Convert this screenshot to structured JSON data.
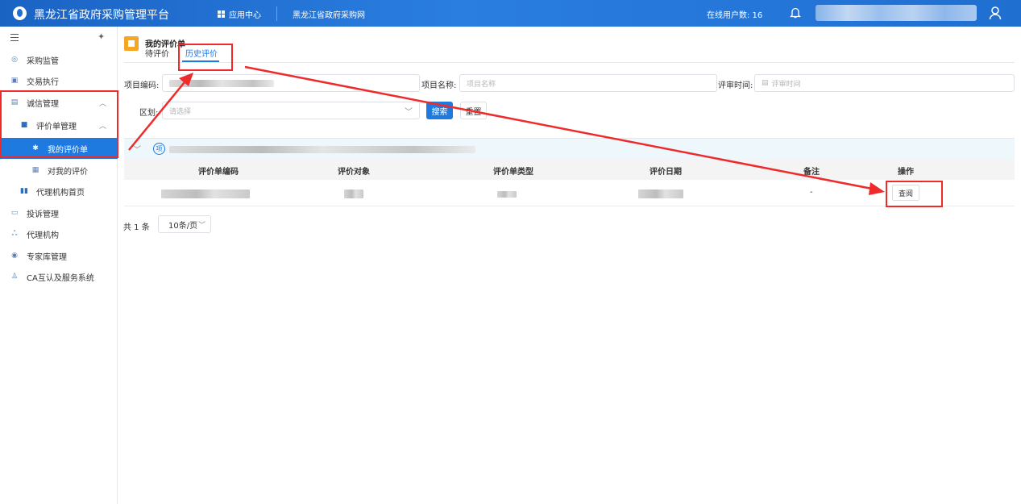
{
  "header": {
    "title": "黑龙江省政府采购管理平台",
    "app_center": "应用中心",
    "site_link": "黑龙江省政府采购网",
    "online_label": "在线用户数: 16"
  },
  "sidebar": {
    "items": [
      {
        "label": "采购监管",
        "icon": "shield-icon"
      },
      {
        "label": "交易执行",
        "icon": "clipboard-icon"
      },
      {
        "label": "诚信管理",
        "icon": "credit-icon"
      },
      {
        "label": "评价单管理",
        "icon": "form-icon"
      },
      {
        "label": "我的评价单",
        "icon": "gear-icon"
      },
      {
        "label": "对我的评价",
        "icon": "document-icon"
      },
      {
        "label": "代理机构首页",
        "icon": "book-icon"
      },
      {
        "label": "投诉管理",
        "icon": "complaint-icon"
      },
      {
        "label": "代理机构",
        "icon": "people-icon"
      },
      {
        "label": "专家库管理",
        "icon": "expert-icon"
      },
      {
        "label": "CA互认及服务系统",
        "icon": "ca-icon"
      }
    ]
  },
  "page": {
    "title": "我的评价单",
    "tabs": [
      {
        "label": "待评价"
      },
      {
        "label": "历史评价"
      }
    ]
  },
  "filters": {
    "project_code_label": "项目编码:",
    "project_name_label": "项目名称:",
    "project_name_placeholder": "项目名称",
    "review_time_label": "评审时间:",
    "review_time_placeholder": "评审时间",
    "region_label": "区划:",
    "region_placeholder": "请选择",
    "search_label": "搜索",
    "reset_label": "重置"
  },
  "table": {
    "group_badge": "项",
    "columns": [
      "评价单编码",
      "评价对象",
      "评价单类型",
      "评价日期",
      "备注",
      "操作"
    ],
    "rows": [
      {
        "remark": "-",
        "action": "查阅"
      }
    ]
  },
  "pagination": {
    "total": "共 1 条",
    "page_size": "10条/页"
  },
  "colors": {
    "header": "#1f6fd1",
    "accent": "#1f7ae0",
    "annotation": "#ef2a2a"
  }
}
